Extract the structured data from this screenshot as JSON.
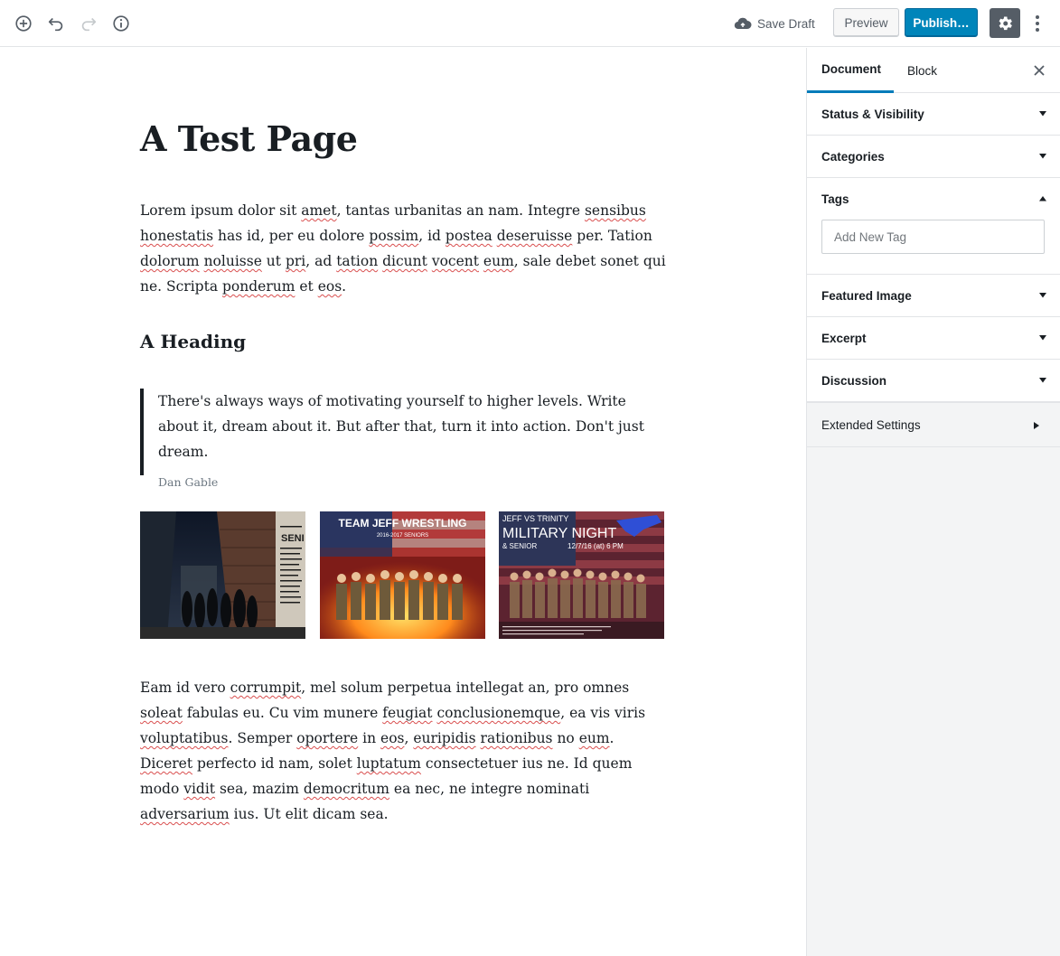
{
  "toolbar": {
    "save_draft_label": "Save Draft",
    "preview_label": "Preview",
    "publish_label": "Publish…",
    "icons": [
      "add-block-icon",
      "undo-icon",
      "redo-icon",
      "info-icon",
      "cloud-upload-icon",
      "gear-icon",
      "more-vertical-icon"
    ],
    "accent_color": "#0085ba"
  },
  "post": {
    "title": "A Test Page",
    "para1": {
      "segments": [
        {
          "t": "Lorem ipsum dolor sit "
        },
        {
          "t": "amet",
          "sq": true
        },
        {
          "t": ", tantas urbanitas an nam. Integre "
        },
        {
          "t": "sensibus",
          "sq": true
        },
        {
          "t": " "
        },
        {
          "t": "honestatis",
          "sq": true
        },
        {
          "t": " has id, per eu dolore "
        },
        {
          "t": "possim",
          "sq": true
        },
        {
          "t": ", id "
        },
        {
          "t": "postea",
          "sq": true
        },
        {
          "t": " "
        },
        {
          "t": "deseruisse",
          "sq": true
        },
        {
          "t": " per. Tation "
        },
        {
          "t": "dolorum",
          "sq": true
        },
        {
          "t": " "
        },
        {
          "t": "noluisse",
          "sq": true
        },
        {
          "t": " ut "
        },
        {
          "t": "pri",
          "sq": true
        },
        {
          "t": ", ad "
        },
        {
          "t": "tation",
          "sq": true
        },
        {
          "t": " "
        },
        {
          "t": "dicunt",
          "sq": true
        },
        {
          "t": " "
        },
        {
          "t": "vocent",
          "sq": true
        },
        {
          "t": " "
        },
        {
          "t": "eum",
          "sq": true
        },
        {
          "t": ", sale debet sonet qui ne. Scripta "
        },
        {
          "t": "ponderum",
          "sq": true
        },
        {
          "t": " et "
        },
        {
          "t": "eos",
          "sq": true
        },
        {
          "t": "."
        }
      ]
    },
    "heading": "A Heading",
    "quote": {
      "text": "There's always ways of motivating yourself to higher levels. Write about it, dream about it. But after that, turn it into action. Don't just dream.",
      "citation": "Dan Gable"
    },
    "gallery": {
      "images": [
        {
          "name": "gallery-image-seniors-alley",
          "text_lines": [
            "SENI"
          ]
        },
        {
          "name": "gallery-image-team-jeff-wrestling",
          "title": "TEAM JEFF WRESTLING",
          "subtitle": "2016-2017 SENIORS"
        },
        {
          "name": "gallery-image-military-night",
          "line1": "JEFF VS TRINITY",
          "line2": "MILITARY NIGHT",
          "line3": "& SENIOR",
          "date": "12/7/16 (at) 6 PM"
        }
      ]
    },
    "para2": {
      "segments": [
        {
          "t": "Eam id vero "
        },
        {
          "t": "corrumpit",
          "sq": true
        },
        {
          "t": ", mel solum perpetua intellegat an, pro omnes "
        },
        {
          "t": "soleat",
          "sq": true
        },
        {
          "t": " fabulas eu. Cu vim munere "
        },
        {
          "t": "feugiat",
          "sq": true
        },
        {
          "t": " "
        },
        {
          "t": "conclusionemque",
          "sq": true
        },
        {
          "t": ", ea vis viris "
        },
        {
          "t": "voluptatibus",
          "sq": true
        },
        {
          "t": ". Semper "
        },
        {
          "t": "oportere",
          "sq": true
        },
        {
          "t": " in "
        },
        {
          "t": "eos",
          "sq": true
        },
        {
          "t": ", "
        },
        {
          "t": "euripidis",
          "sq": true
        },
        {
          "t": " "
        },
        {
          "t": "rationibus",
          "sq": true
        },
        {
          "t": " no "
        },
        {
          "t": "eum",
          "sq": true
        },
        {
          "t": ". "
        },
        {
          "t": "Diceret",
          "sq": true
        },
        {
          "t": " perfecto id nam, solet "
        },
        {
          "t": "luptatum",
          "sq": true
        },
        {
          "t": " consectetuer ius ne. Id quem modo "
        },
        {
          "t": "vidit",
          "sq": true
        },
        {
          "t": " sea, mazim "
        },
        {
          "t": "democritum",
          "sq": true
        },
        {
          "t": " ea nec, ne integre nominati "
        },
        {
          "t": "adversarium",
          "sq": true
        },
        {
          "t": " ius. Ut elit dicam sea."
        }
      ]
    }
  },
  "sidebar": {
    "tabs": [
      {
        "label": "Document",
        "active": true
      },
      {
        "label": "Block",
        "active": false
      }
    ],
    "panels": [
      {
        "label": "Status & Visibility",
        "open": false
      },
      {
        "label": "Categories",
        "open": false
      },
      {
        "label": "Tags",
        "open": true
      },
      {
        "label": "Featured Image",
        "open": false
      },
      {
        "label": "Excerpt",
        "open": false
      },
      {
        "label": "Discussion",
        "open": false
      }
    ],
    "tags_placeholder": "Add New Tag",
    "extended_settings_label": "Extended Settings"
  }
}
